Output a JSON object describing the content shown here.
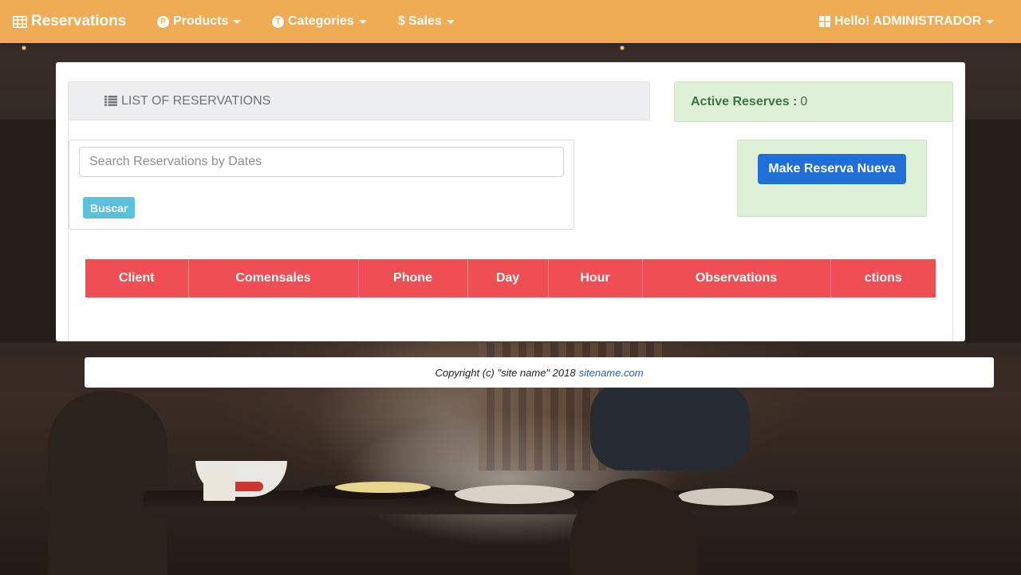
{
  "navbar": {
    "brand": "Reservations",
    "products": "Products",
    "categories": "Categories",
    "sales": "Sales",
    "sales_symbol": "$",
    "user": "Hello! ADMINISTRADOR"
  },
  "panel": {
    "list_title": "LIST OF RESERVATIONS",
    "active_label": "Active Reserves :",
    "active_count": "0"
  },
  "search": {
    "placeholder": "Search Reservations by Dates",
    "button": "Buscar"
  },
  "new_reservation": {
    "button": "Make Reserva Nueva"
  },
  "table": {
    "headers": [
      "Client",
      "Comensales",
      "Phone",
      "Day",
      "Hour",
      "Observations",
      "ctions"
    ]
  },
  "footer": {
    "copyright": "Copyright (c) \"site name\" 2018",
    "link": "sitename.com"
  },
  "colors": {
    "navbar": "#efac55",
    "table_header": "#ef4f54",
    "success_bg": "#dff0d8",
    "primary": "#1f6fd6",
    "info": "#5bc0de"
  },
  "icons": [
    "table-grid-icon",
    "products-p-icon",
    "categories-icon",
    "dollar-icon",
    "windows-icon",
    "list-icon"
  ]
}
